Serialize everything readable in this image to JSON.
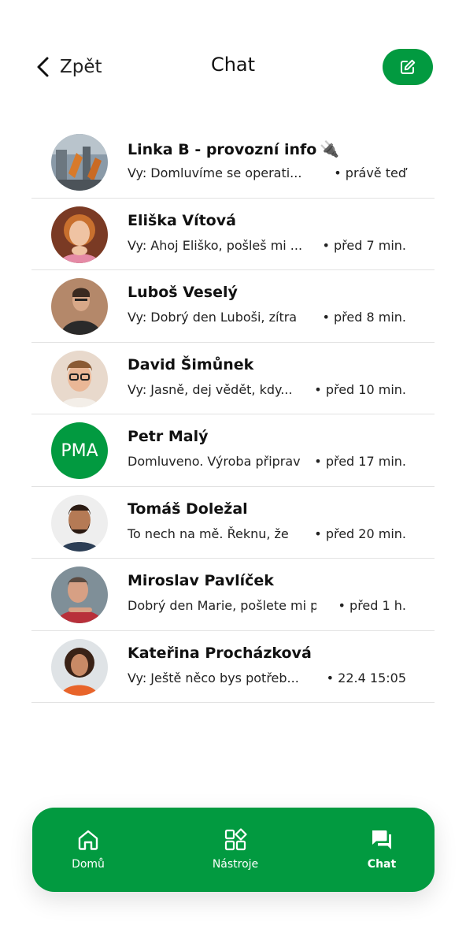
{
  "header": {
    "back_label": "Zpět",
    "title": "Chat"
  },
  "colors": {
    "brand_green": "#029a40",
    "divider": "#e2e2e2"
  },
  "chats": [
    {
      "name": "Linka B - provozní info",
      "name_icon": "🔌",
      "preview": "Vy: Domluvíme se operati...",
      "time": "• právě teď",
      "avatar": "factory-photo"
    },
    {
      "name": "Eliška Vítová",
      "preview": "Vy: Ahoj Eliško, pošleš mi ...",
      "time": "• před 7 min.",
      "avatar": "woman-photo"
    },
    {
      "name": "Luboš Veselý",
      "preview": "Vy: Dobrý den Luboši, zítra",
      "time": "• před 8 min.",
      "avatar": "man-photo"
    },
    {
      "name": "David Šimůnek",
      "preview": "Vy: Jasně, dej vědět, kdy...",
      "time": "• před 10 min.",
      "avatar": "man-glasses-photo"
    },
    {
      "name": "Petr Malý",
      "preview": "Domluveno. Výroba připrav",
      "time": "• před 17 min.",
      "avatar_initials": "PMA"
    },
    {
      "name": "Tomáš Doležal",
      "preview": "To nech na mě. Řeknu, že",
      "time": "• před 20 min.",
      "avatar": "man-beard-photo"
    },
    {
      "name": "Miroslav Pavlíček",
      "preview": "Dobrý den Marie, pošlete mi p",
      "time": "• před 1 h.",
      "avatar": "man-older-photo"
    },
    {
      "name": "Kateřina Procházková",
      "preview": "Vy: Ještě něco bys potřeb...",
      "time": "• 22.4 15:05",
      "avatar": "woman-curly-photo"
    }
  ],
  "tabbar": {
    "tabs": [
      {
        "label": "Domů",
        "icon": "home-icon"
      },
      {
        "label": "Nástroje",
        "icon": "tools-grid-icon"
      },
      {
        "label": "Chat",
        "icon": "chat-bubbles-icon",
        "active": true
      }
    ]
  }
}
